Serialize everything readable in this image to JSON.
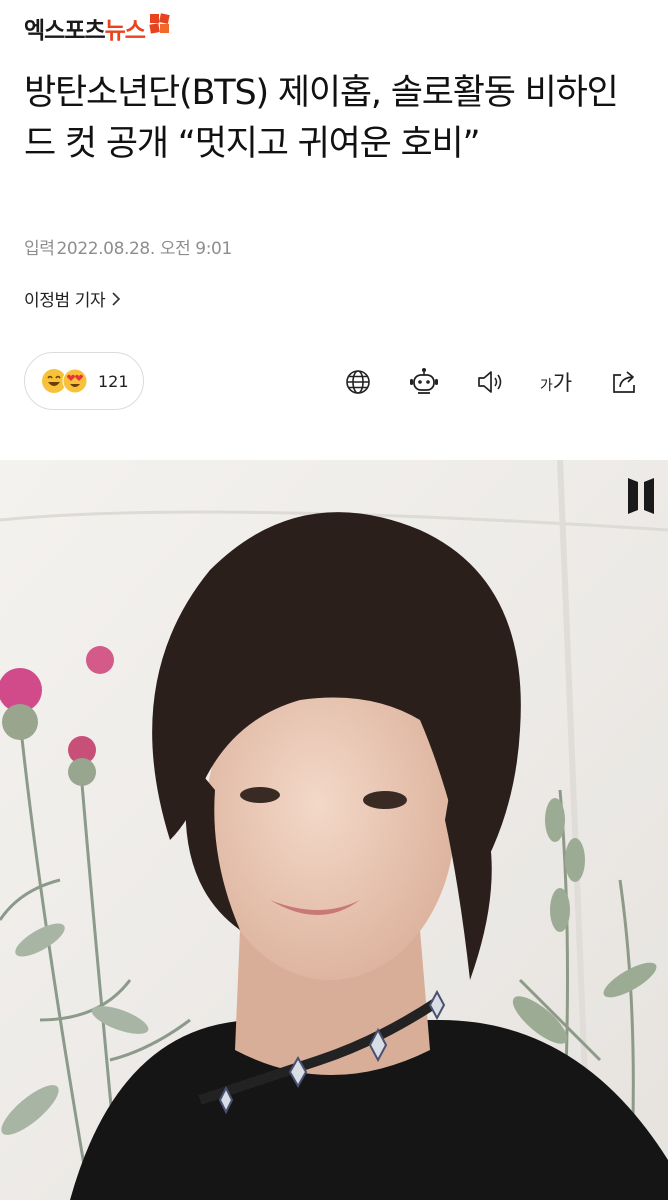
{
  "site": {
    "logo_part1": "엑스포츠",
    "logo_part2": "뉴스"
  },
  "article": {
    "title": "방탄소년단(BTS) 제이홉, 솔로활동 비하인드 컷 공개 “멋지고 귀여운 호비”",
    "published_label": "입력",
    "published_at": "2022.08.28. 오전 9:01",
    "reporter": "이정범 기자"
  },
  "reactions": {
    "count": "121",
    "emoji_icons": [
      "smiling-face-icon",
      "heart-eyes-face-icon"
    ]
  },
  "toolbar": {
    "icons": [
      "globe-icon",
      "robot-summary-icon",
      "speaker-icon",
      "font-size-icon",
      "share-icon"
    ],
    "font_small": "가",
    "font_large": "가"
  },
  "image": {
    "description_icon": "bts-logo-icon"
  }
}
